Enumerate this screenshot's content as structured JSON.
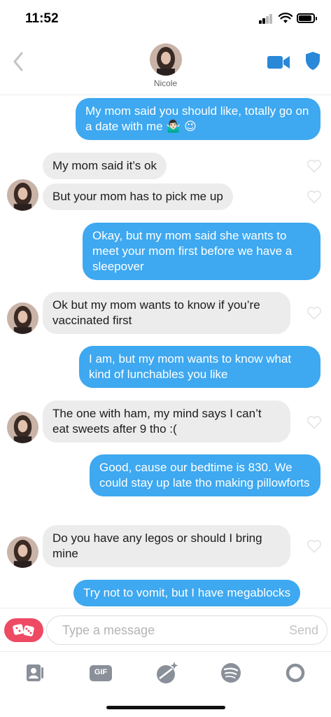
{
  "status_bar": {
    "time": "11:52",
    "battery_level": 0.9
  },
  "header": {
    "contact_name": "Nicole",
    "back_icon": "chevron-left-icon",
    "video_icon": "video-camera-icon",
    "safety_icon": "shield-icon"
  },
  "messages": [
    {
      "from": "me",
      "text": "My mom said you should like, totally go on a date with me 🤷🏻‍♂️ 😉"
    },
    {
      "from": "Nicole",
      "text": "My mom said it’s ok"
    },
    {
      "from": "Nicole",
      "text": "But your mom has to pick me up"
    },
    {
      "from": "me",
      "text": "Okay, but my mom said she wants to meet your mom first before we have a sleepover"
    },
    {
      "from": "Nicole",
      "text": "Ok but my mom wants to know if you’re vaccinated first"
    },
    {
      "from": "me",
      "text": "I am, but my mom wants to know what kind of lunchables you like"
    },
    {
      "from": "Nicole",
      "text": "The one with ham, my mind says I can’t eat sweets after 9 tho :("
    },
    {
      "from": "me",
      "text": "Good, cause our bedtime is 830. We could stay up late tho making pillowforts"
    },
    {
      "from": "Nicole",
      "text": "Do you have any legos or should I bring mine"
    },
    {
      "from": "me",
      "text": "Try not to vomit, but I have megablocks"
    }
  ],
  "composer": {
    "placeholder": "Type a message",
    "send_label": "Send",
    "gifts_icon": "dice-icon"
  },
  "toolbar": {
    "gif_label": "GIF",
    "icons": [
      "contact-card-icon",
      "gif-icon",
      "sticker-icon",
      "spotify-icon",
      "loading-ring-icon"
    ]
  },
  "colors": {
    "sent_bubble": "#3ea8f0",
    "received_bubble": "#ececec",
    "accent_blue": "#2a88d8",
    "gifts_red": "#ee4a63"
  }
}
